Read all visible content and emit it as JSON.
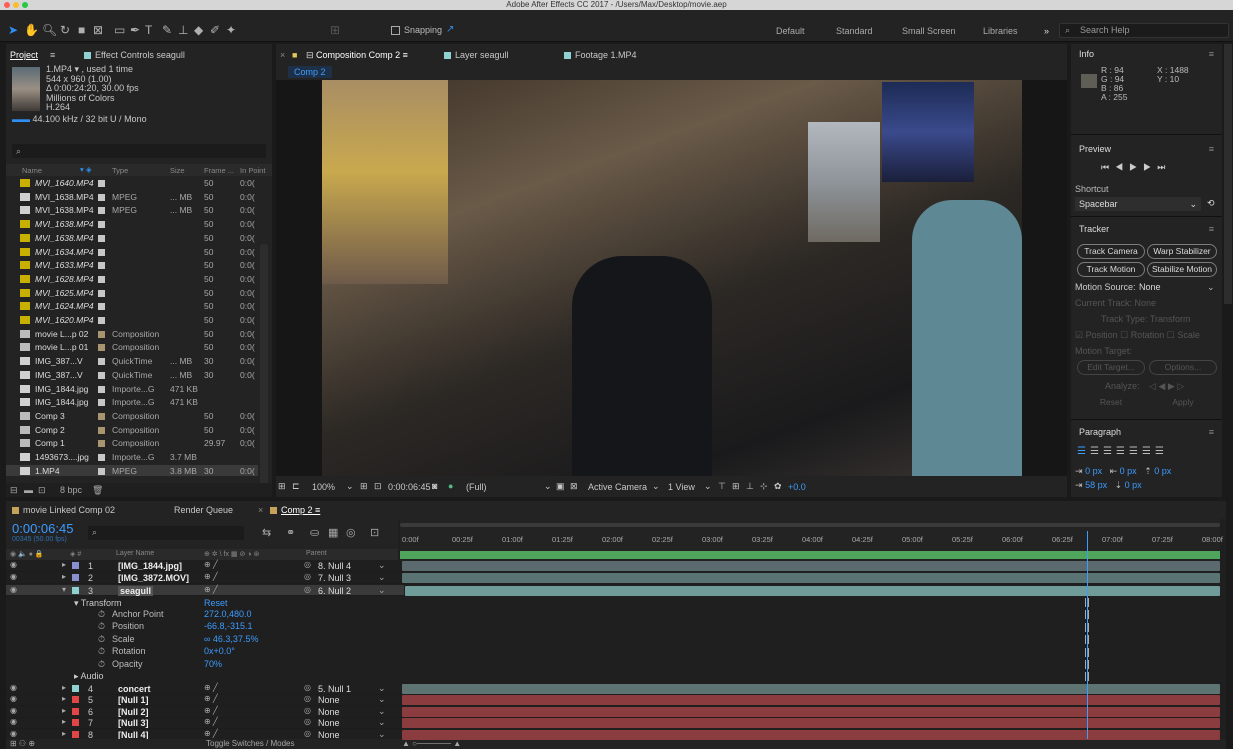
{
  "window": {
    "title": "Adobe After Effects CC 2017 - /Users/Max/Desktop/movie.aep"
  },
  "toolbar": {
    "snapping_label": "Snapping",
    "workspaces": [
      "Default",
      "Standard",
      "Small Screen",
      "Libraries"
    ],
    "more_label": "»",
    "search_placeholder": "Search Help"
  },
  "project": {
    "tabs": [
      "Project",
      "Effect Controls seagull"
    ],
    "footage_info": [
      "1.MP4 ▾ , used 1 time",
      "544 x 960 (1.00)",
      "Δ 0:00:24:20, 30.00 fps",
      "Millions of Colors",
      "H.264",
      "44.100 kHz / 32 bit U / Mono"
    ],
    "search_placeholder": "",
    "columns": [
      "Name",
      "Type",
      "Size",
      "Frame ...",
      "In Point"
    ],
    "items": [
      {
        "name": "MVI_1640.MP4",
        "type": "",
        "size": "",
        "frame": "50",
        "inpoint": "0:0(",
        "icon": "footage-missing-icon",
        "italic": true
      },
      {
        "name": "MVI_1638.MP4",
        "type": "MPEG",
        "size": "... MB",
        "frame": "50",
        "inpoint": "0:0(",
        "icon": "footage-icon",
        "italic": false
      },
      {
        "name": "MVI_1638.MP4",
        "type": "MPEG",
        "size": "... MB",
        "frame": "50",
        "inpoint": "0:0(",
        "icon": "footage-icon",
        "italic": false
      },
      {
        "name": "MVI_1638.MP4",
        "type": "",
        "size": "",
        "frame": "50",
        "inpoint": "0:0(",
        "icon": "footage-missing-icon",
        "italic": true
      },
      {
        "name": "MVI_1638.MP4",
        "type": "",
        "size": "",
        "frame": "50",
        "inpoint": "0:0(",
        "icon": "footage-missing-icon",
        "italic": true
      },
      {
        "name": "MVI_1634.MP4",
        "type": "",
        "size": "",
        "frame": "50",
        "inpoint": "0:0(",
        "icon": "footage-missing-icon",
        "italic": true
      },
      {
        "name": "MVI_1633.MP4",
        "type": "",
        "size": "",
        "frame": "50",
        "inpoint": "0:0(",
        "icon": "footage-missing-icon",
        "italic": true
      },
      {
        "name": "MVI_1628.MP4",
        "type": "",
        "size": "",
        "frame": "50",
        "inpoint": "0:0(",
        "icon": "footage-missing-icon",
        "italic": true
      },
      {
        "name": "MVI_1625.MP4",
        "type": "",
        "size": "",
        "frame": "50",
        "inpoint": "0:0(",
        "icon": "footage-missing-icon",
        "italic": true
      },
      {
        "name": "MVI_1624.MP4",
        "type": "",
        "size": "",
        "frame": "50",
        "inpoint": "0:0(",
        "icon": "footage-missing-icon",
        "italic": true
      },
      {
        "name": "MVI_1620.MP4",
        "type": "",
        "size": "",
        "frame": "50",
        "inpoint": "0:0(",
        "icon": "footage-missing-icon",
        "italic": true
      },
      {
        "name": "movie L...p 02",
        "type": "Composition",
        "size": "",
        "frame": "50",
        "inpoint": "0:0(",
        "icon": "composition-icon",
        "italic": false
      },
      {
        "name": "movie L...p 01",
        "type": "Composition",
        "size": "",
        "frame": "50",
        "inpoint": "0:0(",
        "icon": "composition-icon",
        "italic": false
      },
      {
        "name": "IMG_387...V",
        "type": "QuickTime",
        "size": "... MB",
        "frame": "30",
        "inpoint": "0:0(",
        "icon": "footage-icon",
        "italic": false
      },
      {
        "name": "IMG_387...V",
        "type": "QuickTime",
        "size": "... MB",
        "frame": "30",
        "inpoint": "0:0(",
        "icon": "footage-icon",
        "italic": false
      },
      {
        "name": "IMG_1844.jpg",
        "type": "Importe...G",
        "size": "471 KB",
        "frame": "",
        "inpoint": "",
        "icon": "image-icon",
        "italic": false
      },
      {
        "name": "IMG_1844.jpg",
        "type": "Importe...G",
        "size": "471 KB",
        "frame": "",
        "inpoint": "",
        "icon": "image-icon",
        "italic": false
      },
      {
        "name": "Comp 3",
        "type": "Composition",
        "size": "",
        "frame": "50",
        "inpoint": "0:0(",
        "icon": "composition-icon",
        "italic": false
      },
      {
        "name": "Comp 2",
        "type": "Composition",
        "size": "",
        "frame": "50",
        "inpoint": "0:0(",
        "icon": "composition-icon",
        "italic": false
      },
      {
        "name": "Comp 1",
        "type": "Composition",
        "size": "",
        "frame": "29.97",
        "inpoint": "0;0(",
        "icon": "composition-icon",
        "italic": false
      },
      {
        "name": "1493673....jpg",
        "type": "Importe...G",
        "size": "3.7 MB",
        "frame": "",
        "inpoint": "",
        "icon": "image-icon",
        "italic": false
      },
      {
        "name": "1.MP4",
        "type": "MPEG",
        "size": "3.8 MB",
        "frame": "30",
        "inpoint": "0:0(",
        "icon": "footage-icon",
        "italic": false
      }
    ],
    "bpc_label": "8 bpc"
  },
  "viewer": {
    "tabs": [
      "Composition Comp 2",
      "Layer seagull",
      "Footage 1.MP4"
    ],
    "comp_chip": "Comp 2",
    "zoom": "100%",
    "timecode": "0:00:06:45",
    "resolution": "(Full)",
    "camera": "Active Camera",
    "views": "1 View",
    "exposure": "+0.0"
  },
  "info": {
    "title": "Info",
    "r": "R : 94",
    "g": "G : 94",
    "b": "B : 86",
    "a": "A : 255",
    "x": "X : 1488",
    "y": "Y : 10"
  },
  "preview": {
    "title": "Preview",
    "shortcut_label": "Shortcut",
    "shortcut_value": "Spacebar"
  },
  "tracker": {
    "title": "Tracker",
    "buttons": [
      "Track Camera",
      "Warp Stabilizer",
      "Track Motion",
      "Stabilize Motion"
    ],
    "motion_source_label": "Motion Source:",
    "motion_source_value": "None",
    "current_track": "Current Track:  None",
    "track_type": "Track Type:  Transform",
    "position": "Position",
    "rotation": "Rotation",
    "scale": "Scale",
    "motion_target": "Motion Target:",
    "edit_target": "Edit Target...",
    "options": "Options...",
    "analyze": "Analyze:",
    "reset": "Reset",
    "apply": "Apply"
  },
  "paragraph": {
    "title": "Paragraph",
    "indent_left": "0 px",
    "indent_right": "0 px",
    "space_before": "0 px",
    "first_line": "58 px",
    "space_after": "0 px"
  },
  "timeline": {
    "tabs": [
      "movie Linked Comp 02",
      "Render Queue",
      "Comp 2"
    ],
    "timecode": "0:00:06:45",
    "frame_info": "00345 (50.00 fps)",
    "col_layer_name": "Layer Name",
    "col_parent": "Parent",
    "ruler": [
      "0:00f",
      "00:25f",
      "01:00f",
      "01:25f",
      "02:00f",
      "02:25f",
      "03:00f",
      "03:25f",
      "04:00f",
      "04:25f",
      "05:00f",
      "05:25f",
      "06:00f",
      "06:25f",
      "07:00f",
      "07:25f",
      "08:00f"
    ],
    "playhead_fraction": 0.838,
    "layers": [
      {
        "num": "1",
        "name": "[IMG_1844.jpg]",
        "parent": "8. Null 4",
        "color": "#8a8fd0",
        "bar": "#5a6a6e",
        "bar_start": 0.0
      },
      {
        "num": "2",
        "name": "[IMG_3872.MOV]",
        "parent": "7. Null 3",
        "color": "#8a8fd0",
        "bar": "#5a7473",
        "bar_start": 0.0
      },
      {
        "num": "3",
        "name": "seagull",
        "parent": "6. Null 2",
        "color": "#8fd1d0",
        "bar": "#6f9b98",
        "bar_start": 0.004
      }
    ],
    "transform": {
      "label": "Transform",
      "reset": "Reset",
      "props": [
        {
          "name": "Anchor Point",
          "value": "272.0,480.0"
        },
        {
          "name": "Position",
          "value": "-66.8,-315.1"
        },
        {
          "name": "Scale",
          "value": "∞ 46.3,37.5%"
        },
        {
          "name": "Rotation",
          "value": "0x+0.0°"
        },
        {
          "name": "Opacity",
          "value": "70%"
        }
      ]
    },
    "audio_label": "Audio",
    "layers2": [
      {
        "num": "4",
        "name": "concert",
        "parent": "5. Null 1",
        "color": "#8fd1d0",
        "bar": "#5d7473"
      },
      {
        "num": "5",
        "name": "[Null 1]",
        "parent": "None",
        "color": "#e04646",
        "bar": "#8a3c3f"
      },
      {
        "num": "6",
        "name": "[Null 2]",
        "parent": "None",
        "color": "#e04646",
        "bar": "#8a3c3f"
      },
      {
        "num": "7",
        "name": "[Null 3]",
        "parent": "None",
        "color": "#e04646",
        "bar": "#8a3c3f"
      },
      {
        "num": "8",
        "name": "[Null 4]",
        "parent": "None",
        "color": "#e04646",
        "bar": "#8a3c3f"
      }
    ],
    "toggle_label": "Toggle Switches / Modes"
  }
}
